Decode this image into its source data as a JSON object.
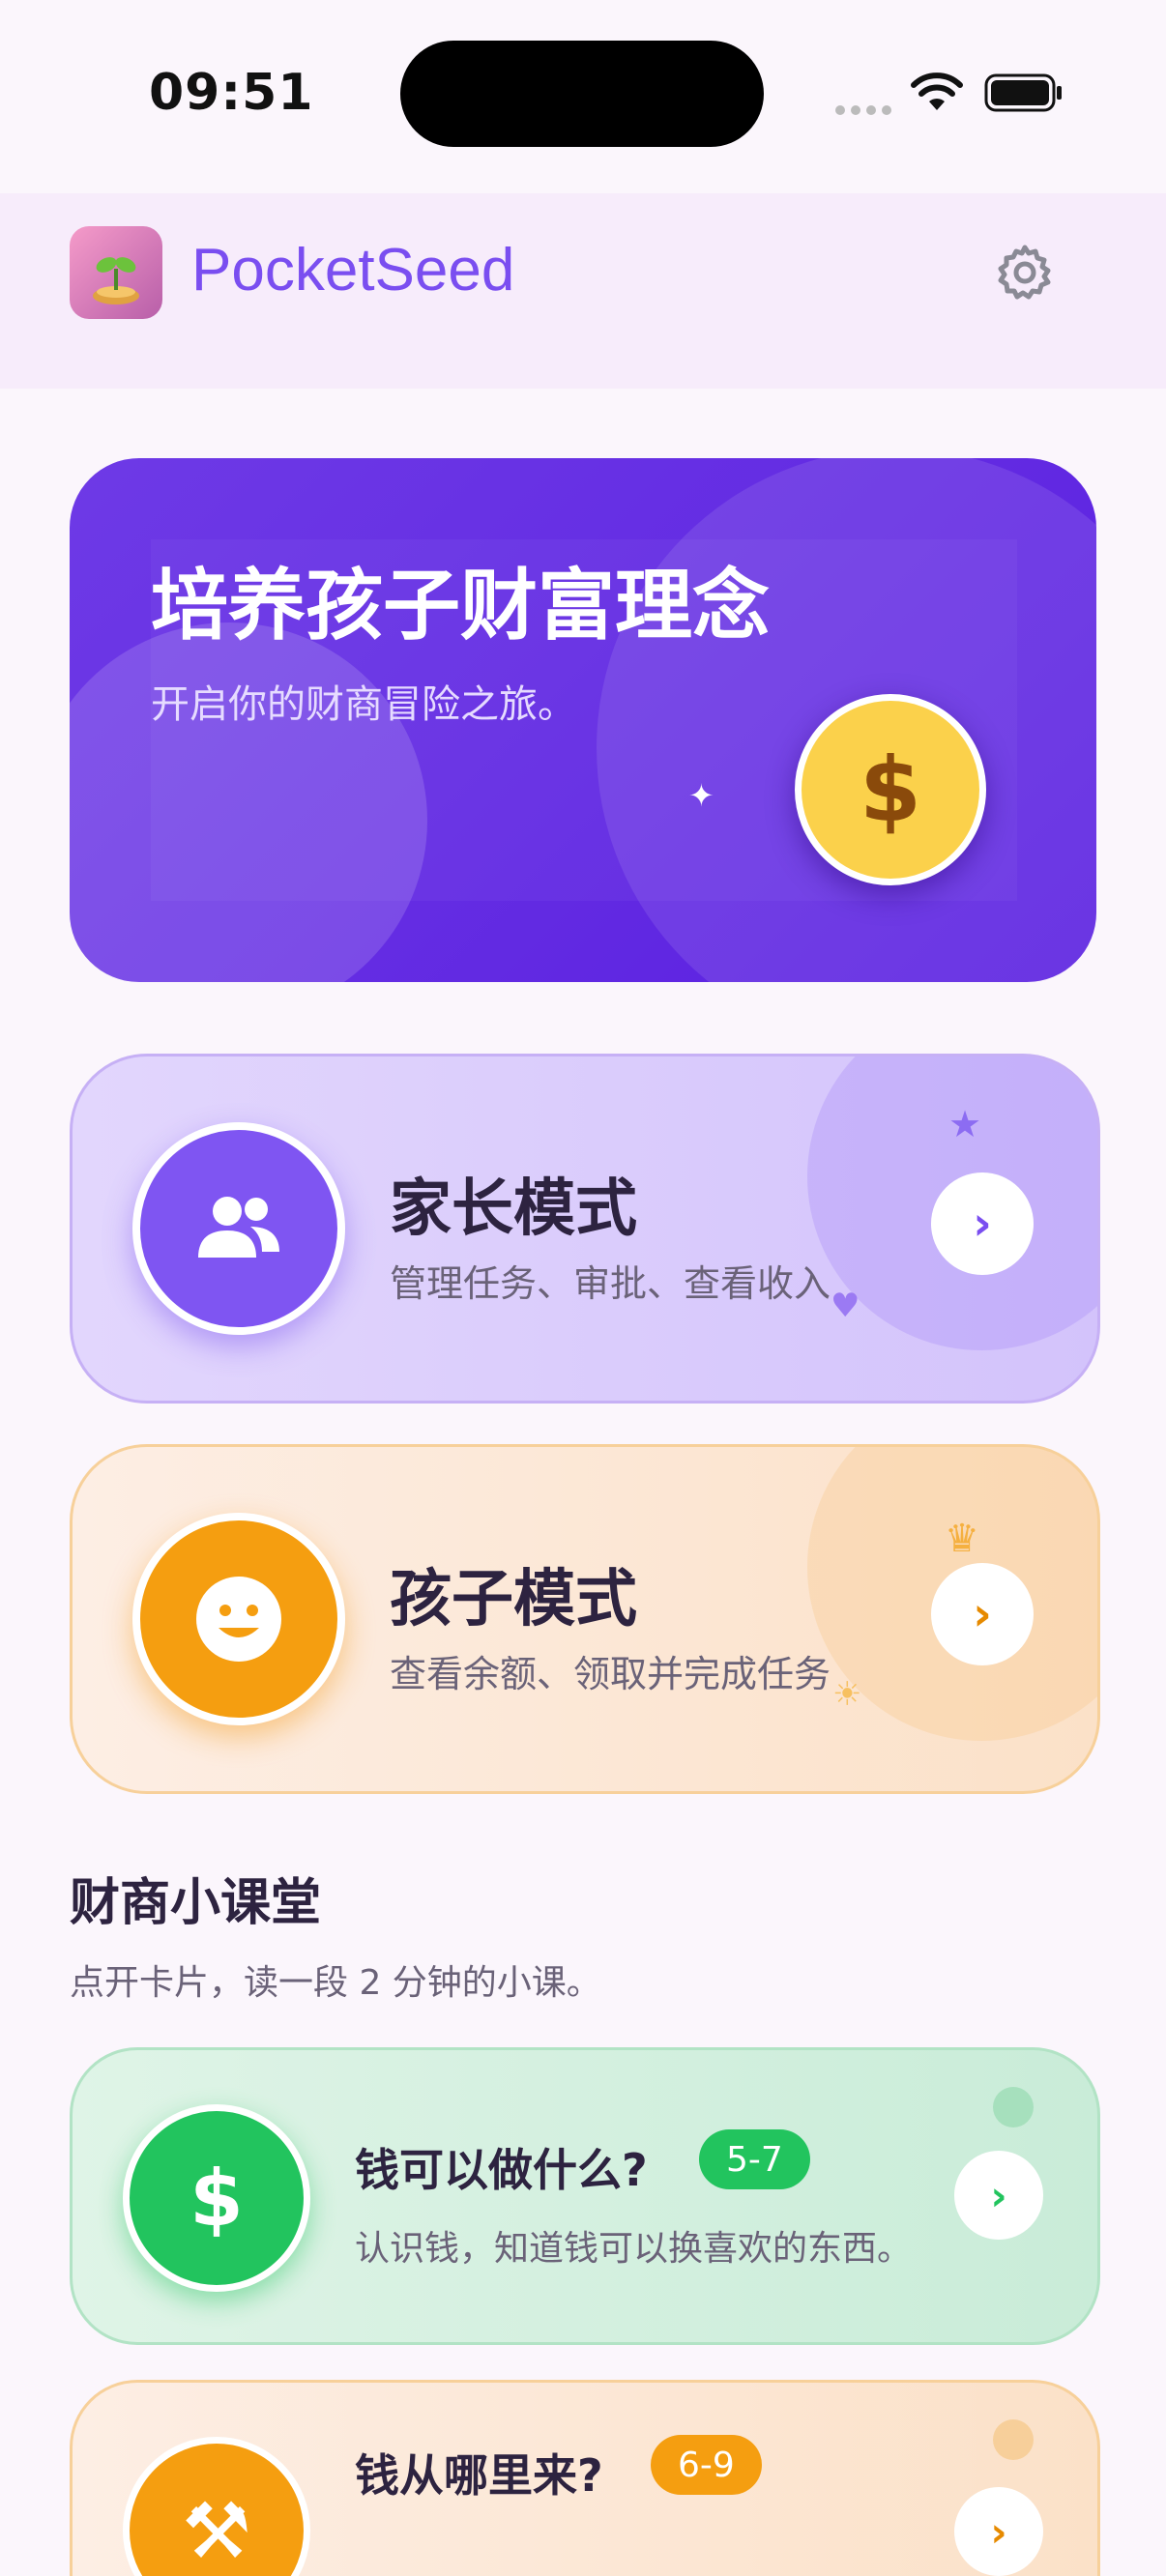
{
  "status_bar": {
    "time": "09:51"
  },
  "header": {
    "app_name": "PocketSeed"
  },
  "hero": {
    "title": "培养孩子财富理念",
    "subtitle": "开启你的财商冒险之旅。",
    "coin_symbol": "$"
  },
  "modes": [
    {
      "title": "家长模式",
      "description": "管理任务、审批、查看收入",
      "accent": "#7f55f2"
    },
    {
      "title": "孩子模式",
      "description": "查看余额、领取并完成任务",
      "accent": "#f59e10"
    }
  ],
  "section": {
    "title": "财商小课堂",
    "subtitle": "点开卡片，读一段 2 分钟的小课。"
  },
  "lessons": [
    {
      "title": "钱可以做什么?",
      "age": "5-7",
      "description": "认识钱，知道钱可以换喜欢的东西。",
      "icon_symbol": "$",
      "accent": "#22c45e"
    },
    {
      "title": "钱从哪里来?",
      "age": "6-9",
      "icon_symbol": "⚒",
      "accent": "#f59e10"
    }
  ],
  "icons": {
    "settings": "gear-icon",
    "parent": "users-icon",
    "kid": "smile-icon",
    "arrow": "chevron-right-icon"
  }
}
